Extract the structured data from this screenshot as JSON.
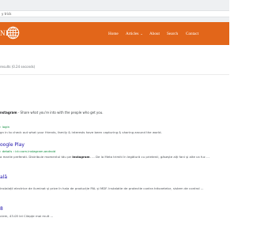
{
  "browser": {
    "address_text": "y trick"
  },
  "navbar": {
    "brand": "NE",
    "menu": [
      "Home",
      "Articles",
      "About",
      "Search",
      "Contact"
    ]
  },
  "search": {
    "stats": "results (0.24 seconds)"
  },
  "results": {
    "r0_snippet_bold": "nstagram",
    "r0_snippet_rest": " - Share what you're into with the people who get you.",
    "r1_cite": "› login",
    "r1_snippet": "gn in to check out what your friends, family & interests have been capturing & sharing around the world.",
    "r2_title": "oogle Play",
    "r2_cite": "› details › id=com.instagram.android",
    "r2_snippet_a": "a marile preferati. Distribuie momentul tău pe ",
    "r2_snippet_bold": "Instagram",
    "r2_snippet_b": ". ... De la Meta trimiti în legătură cu prietenii, găsește alți fani și alte ca fuc ...",
    "r3_title": "ală",
    "r3_snippet": "instalații electrice de iluminat și prize în hala de producție PAL și MDF. Instalatie de protectie contra trăsnetelor, sistem de control ...",
    "r4_title": "8",
    "r4_snippet": "ciem, 43.05 lei Cilepțe mai mult ..."
  },
  "colors": {
    "nav_bg": "#e2661a",
    "link": "#1a0dab",
    "url": "#0a8a3a"
  }
}
